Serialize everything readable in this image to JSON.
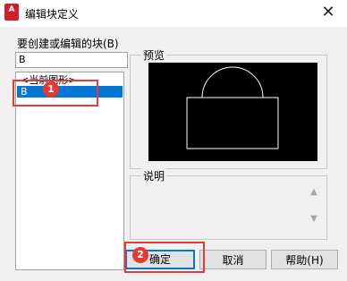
{
  "window": {
    "app_icon_text": "A",
    "title": "编辑块定义",
    "close_glyph": "✕"
  },
  "block_name": {
    "label": "要创建或编辑的块(B)",
    "value": "B"
  },
  "block_list": {
    "items": [
      {
        "label": "<当前图形>",
        "selected": false
      },
      {
        "label": "B",
        "selected": true
      }
    ]
  },
  "preview": {
    "label": "预览"
  },
  "description": {
    "label": "说明",
    "text": ""
  },
  "buttons": {
    "ok": "确定",
    "cancel": "取消",
    "help": "帮助(H)"
  },
  "annotations": {
    "step1": "1",
    "step2": "2",
    "color": "#e53935"
  },
  "colors": {
    "accent": "#0078d7",
    "preview_bg": "#000000",
    "preview_stroke": "#ffffff"
  }
}
